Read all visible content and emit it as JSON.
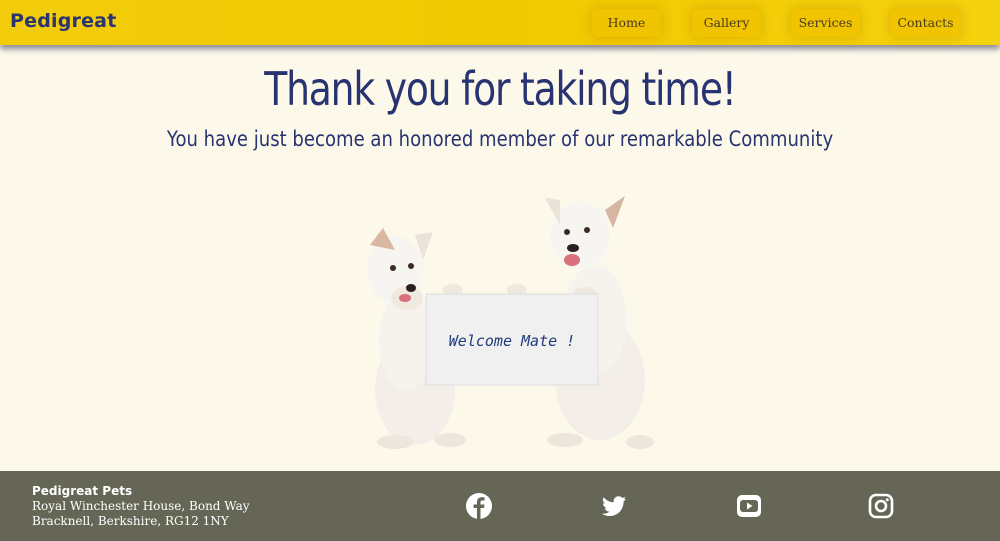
{
  "header": {
    "brand": "Pedigreat",
    "nav": [
      {
        "label": "Home"
      },
      {
        "label": "Gallery"
      },
      {
        "label": "Services"
      },
      {
        "label": "Contacts"
      }
    ]
  },
  "hero": {
    "title": "Thank you for taking time!",
    "subtitle": "You have just become an honored member of our remarkable Community"
  },
  "image": {
    "sign_text": "Welcome Mate !"
  },
  "footer": {
    "company": "Pedigreat Pets",
    "address_line1": "Royal Winchester House, Bond Way",
    "address_line2": "Bracknell, Berkshire, RG12 1NY",
    "social": [
      {
        "icon": "facebook-icon"
      },
      {
        "icon": "twitter-icon"
      },
      {
        "icon": "youtube-icon"
      },
      {
        "icon": "instagram-icon"
      }
    ]
  },
  "colors": {
    "header_bg": "#f1c900",
    "page_bg": "#fdf9ea",
    "brand_text": "#283371",
    "footer_bg": "#666656"
  }
}
